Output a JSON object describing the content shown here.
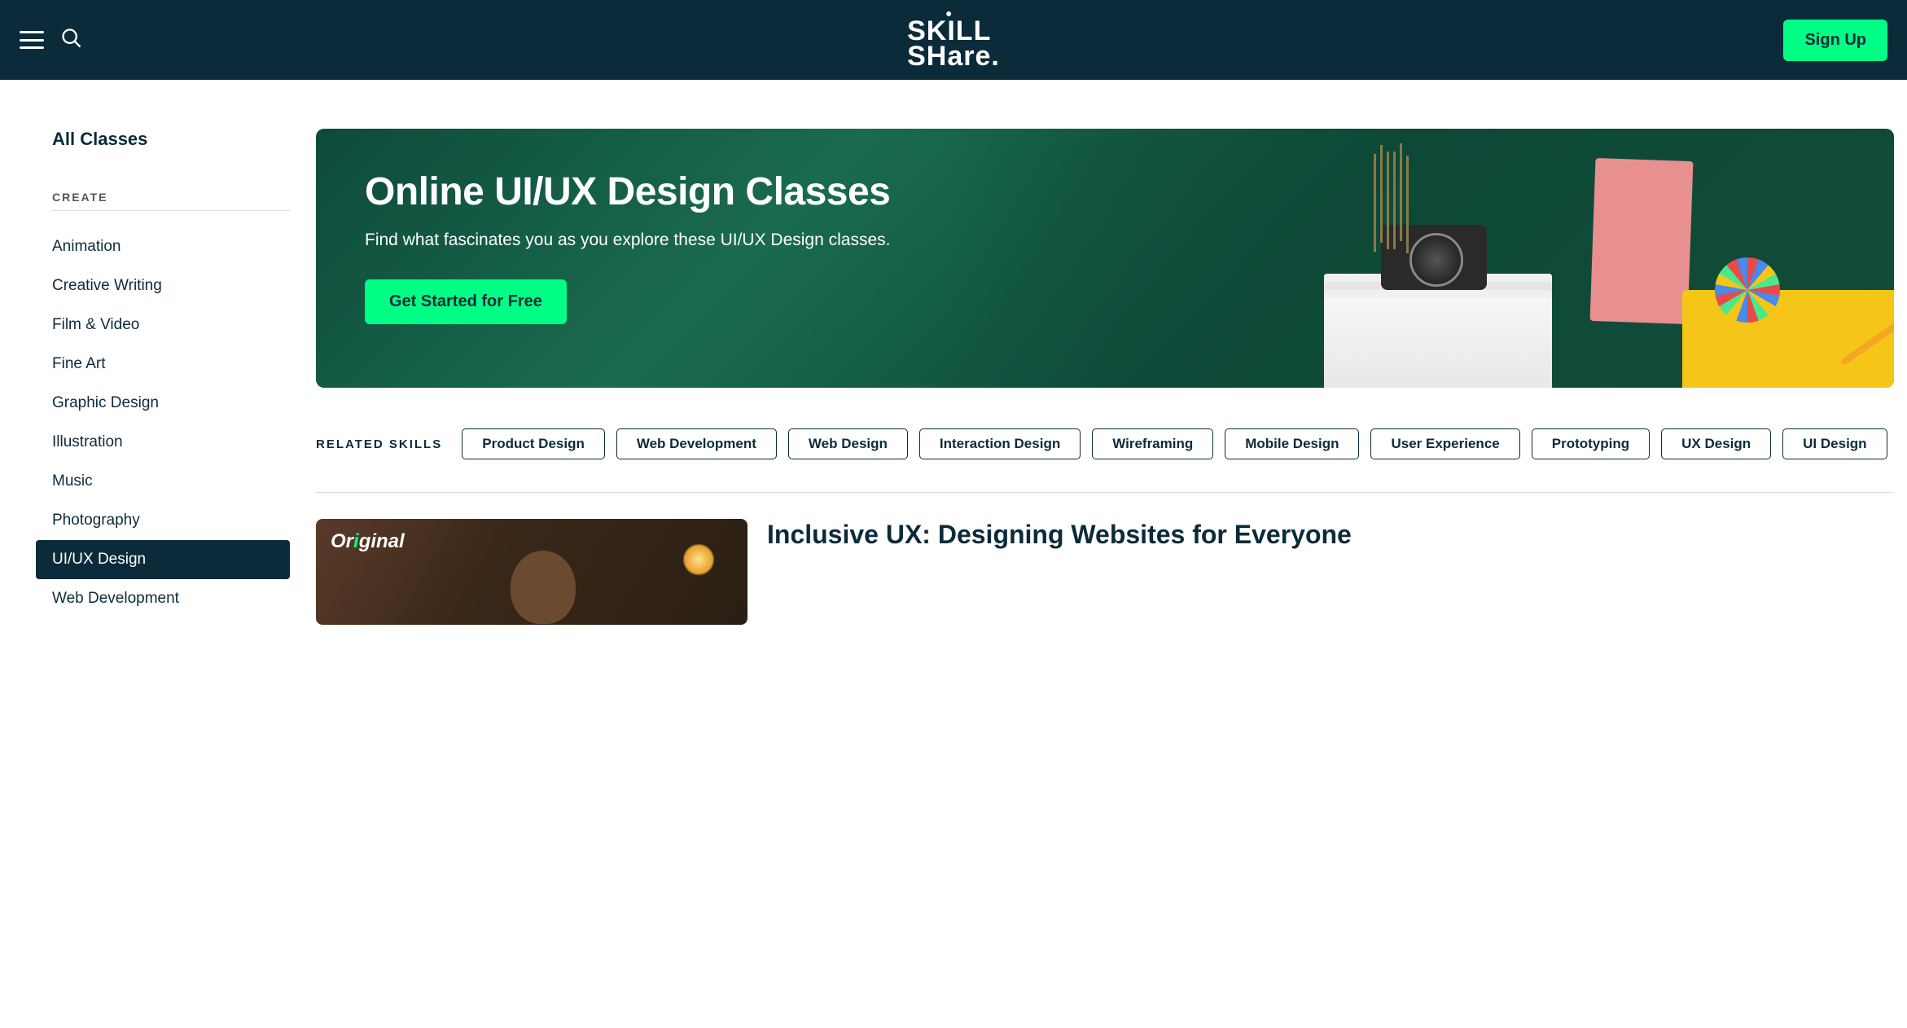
{
  "header": {
    "signup_label": "Sign Up",
    "logo_line1": "SKILL",
    "logo_line2": "SHare."
  },
  "sidebar": {
    "all_classes": "All Classes",
    "category_header": "CREATE",
    "items": [
      "Animation",
      "Creative Writing",
      "Film & Video",
      "Fine Art",
      "Graphic Design",
      "Illustration",
      "Music",
      "Photography",
      "UI/UX Design",
      "Web Development"
    ],
    "active_index": 8
  },
  "hero": {
    "title": "Online UI/UX Design Classes",
    "subtitle": "Find what fascinates you as you explore these UI/UX Design classes.",
    "cta": "Get Started for Free"
  },
  "related": {
    "label": "RELATED SKILLS",
    "skills": [
      "Product Design",
      "Web Development",
      "Web Design",
      "Interaction Design",
      "Wireframing",
      "Mobile Design",
      "User Experience",
      "Prototyping",
      "UX Design",
      "UI Design"
    ]
  },
  "featured": {
    "badge": "Original",
    "title": "Inclusive UX: Designing Websites for Everyone"
  }
}
